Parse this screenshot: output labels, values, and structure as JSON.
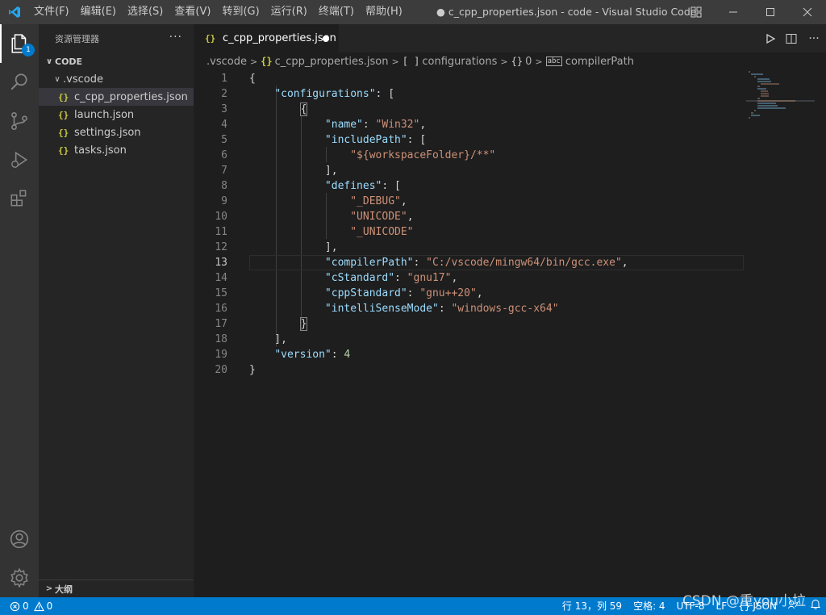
{
  "titlebar": {
    "menus": [
      "文件(F)",
      "编辑(E)",
      "选择(S)",
      "查看(V)",
      "转到(G)",
      "运行(R)",
      "终端(T)",
      "帮助(H)"
    ],
    "window_title": "● c_cpp_properties.json - code - Visual Studio Code"
  },
  "activitybar": {
    "explorer_badge": "1"
  },
  "sidebar": {
    "title": "资源管理器",
    "more": "···",
    "section": "CODE",
    "folder": ".vscode",
    "files": [
      "c_cpp_properties.json",
      "launch.json",
      "settings.json",
      "tasks.json"
    ],
    "outline": "大纲"
  },
  "tab": {
    "label": "c_cpp_properties.json",
    "icon": "{}"
  },
  "breadcrumb": {
    "folder": ".vscode",
    "file": "c_cpp_properties.json",
    "configurations": "configurations",
    "index": "0",
    "symbol": "compilerPath",
    "array_sym": "[ ]",
    "obj_sym": "{}",
    "str_sym": "abc"
  },
  "code": {
    "line_numbers": [
      "1",
      "2",
      "3",
      "4",
      "5",
      "6",
      "7",
      "8",
      "9",
      "10",
      "11",
      "12",
      "13",
      "14",
      "15",
      "16",
      "17",
      "18",
      "19",
      "20"
    ],
    "current_line": 13,
    "lines": [
      [
        [
          "p",
          "{"
        ]
      ],
      [
        [
          "p",
          "    "
        ],
        [
          "k",
          "\"configurations\""
        ],
        [
          "p",
          ": ["
        ]
      ],
      [
        [
          "p",
          "        {"
        ]
      ],
      [
        [
          "p",
          "            "
        ],
        [
          "k",
          "\"name\""
        ],
        [
          "p",
          ": "
        ],
        [
          "s",
          "\"Win32\""
        ],
        [
          "p",
          ","
        ]
      ],
      [
        [
          "p",
          "            "
        ],
        [
          "k",
          "\"includePath\""
        ],
        [
          "p",
          ": ["
        ]
      ],
      [
        [
          "p",
          "                "
        ],
        [
          "s",
          "\"${workspaceFolder}/**\""
        ]
      ],
      [
        [
          "p",
          "            ],"
        ]
      ],
      [
        [
          "p",
          "            "
        ],
        [
          "k",
          "\"defines\""
        ],
        [
          "p",
          ": ["
        ]
      ],
      [
        [
          "p",
          "                "
        ],
        [
          "s",
          "\"_DEBUG\""
        ],
        [
          "p",
          ","
        ]
      ],
      [
        [
          "p",
          "                "
        ],
        [
          "s",
          "\"UNICODE\""
        ],
        [
          "p",
          ","
        ]
      ],
      [
        [
          "p",
          "                "
        ],
        [
          "s",
          "\"_UNICODE\""
        ]
      ],
      [
        [
          "p",
          "            ],"
        ]
      ],
      [
        [
          "p",
          "            "
        ],
        [
          "k",
          "\"compilerPath\""
        ],
        [
          "p",
          ": "
        ],
        [
          "s",
          "\"C:/vscode/mingw64/bin/gcc.exe\""
        ],
        [
          "p",
          ","
        ]
      ],
      [
        [
          "p",
          "            "
        ],
        [
          "k",
          "\"cStandard\""
        ],
        [
          "p",
          ": "
        ],
        [
          "s",
          "\"gnu17\""
        ],
        [
          "p",
          ","
        ]
      ],
      [
        [
          "p",
          "            "
        ],
        [
          "k",
          "\"cppStandard\""
        ],
        [
          "p",
          ": "
        ],
        [
          "s",
          "\"gnu++20\""
        ],
        [
          "p",
          ","
        ]
      ],
      [
        [
          "p",
          "            "
        ],
        [
          "k",
          "\"intelliSenseMode\""
        ],
        [
          "p",
          ": "
        ],
        [
          "s",
          "\"windows-gcc-x64\""
        ]
      ],
      [
        [
          "p",
          "        }"
        ]
      ],
      [
        [
          "p",
          "    ],"
        ]
      ],
      [
        [
          "p",
          "    "
        ],
        [
          "k",
          "\"version\""
        ],
        [
          "p",
          ": "
        ],
        [
          "n",
          "4"
        ]
      ],
      [
        [
          "p",
          "}"
        ]
      ]
    ]
  },
  "statusbar": {
    "errors": "0",
    "warnings": "0",
    "position": "行 13，列 59",
    "spaces": "空格: 4",
    "encoding": "UTF-8",
    "eol": "LF",
    "language": "JSON"
  },
  "watermark": "CSDN @重you小垃",
  "colors": {
    "accent": "#007acc",
    "key": "#9cdcfe",
    "string": "#ce9178",
    "number": "#b5cea8",
    "json_icon": "#cbcb41"
  }
}
